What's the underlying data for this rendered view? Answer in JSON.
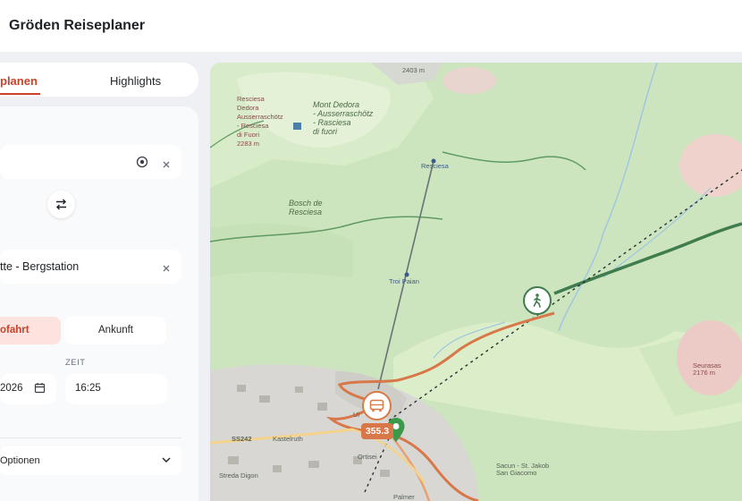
{
  "header": {
    "title": "Gröden Reiseplaner"
  },
  "tabs": {
    "plan_label": "planen",
    "highlights_label": "Highlights"
  },
  "form": {
    "destination_value": "tte - Bergstation",
    "depart_label": "ofahrt",
    "arrive_label": "Ankunft",
    "time_label": "ZEIT",
    "date_value": "2026",
    "time_value": "16:25",
    "options_label": "Optionen"
  },
  "map": {
    "labels": {
      "dedora": "Resciesa\nDedora\nAusserraschötz\n- Resciesa\ndi Fuori\n2283 m",
      "mont_dedora": "Mont Dedora\n- Ausserraschötz\n- Rasciesa\ndi fuori",
      "bosch": "Bosch de\nResciesa",
      "resciesa_station": "Resciesa",
      "troi_paian": "Troi Paian",
      "seurasas": "Seurasas\n2176 m",
      "sacun": "Sacun - St. Jakob\nSan Giacomo",
      "road_number": "SS242",
      "kastelruth": "Kastelruth",
      "streda": "Streda Digon",
      "ortisei": "Ortisei",
      "palmer": "Palmer",
      "ulrich": "Ul",
      "summit_top": "2403 m"
    },
    "elevation_badge": "355.3",
    "colors": {
      "route": "#d8774a",
      "trail": "#3f7d4f",
      "accent": "#c8432a"
    }
  }
}
